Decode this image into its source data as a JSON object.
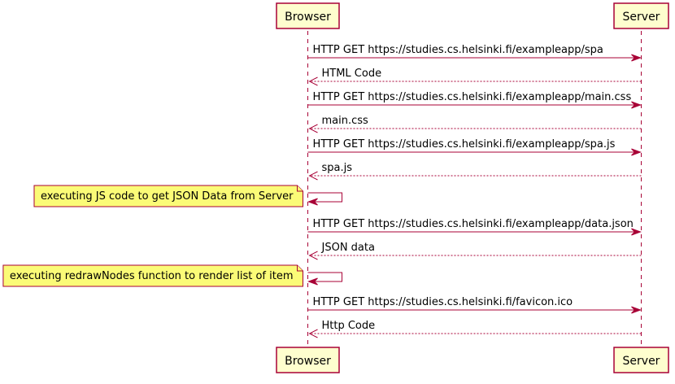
{
  "participants": {
    "browser": "Browser",
    "server": "Server"
  },
  "colors": {
    "line": "#A80036",
    "participant_fill": "#FEFECE",
    "note_fill": "#FBFB77"
  },
  "messages": [
    {
      "kind": "request",
      "label": "HTTP GET https://studies.cs.helsinki.fi/exampleapp/spa"
    },
    {
      "kind": "response",
      "label": "HTML Code"
    },
    {
      "kind": "request",
      "label": "HTTP GET https://studies.cs.helsinki.fi/exampleapp/main.css"
    },
    {
      "kind": "response",
      "label": "main.css"
    },
    {
      "kind": "request",
      "label": "HTTP GET https://studies.cs.helsinki.fi/exampleapp/spa.js"
    },
    {
      "kind": "response",
      "label": "spa.js"
    },
    {
      "kind": "self",
      "label": "executing JS code to get JSON Data from Server"
    },
    {
      "kind": "request",
      "label": "HTTP GET https://studies.cs.helsinki.fi/exampleapp/data.json"
    },
    {
      "kind": "response",
      "label": "JSON data"
    },
    {
      "kind": "self",
      "label": "executing redrawNodes function to render list of item"
    },
    {
      "kind": "request",
      "label": "HTTP GET https://studies.cs.helsinki.fi/favicon.ico"
    },
    {
      "kind": "response",
      "label": "Http Code"
    }
  ]
}
